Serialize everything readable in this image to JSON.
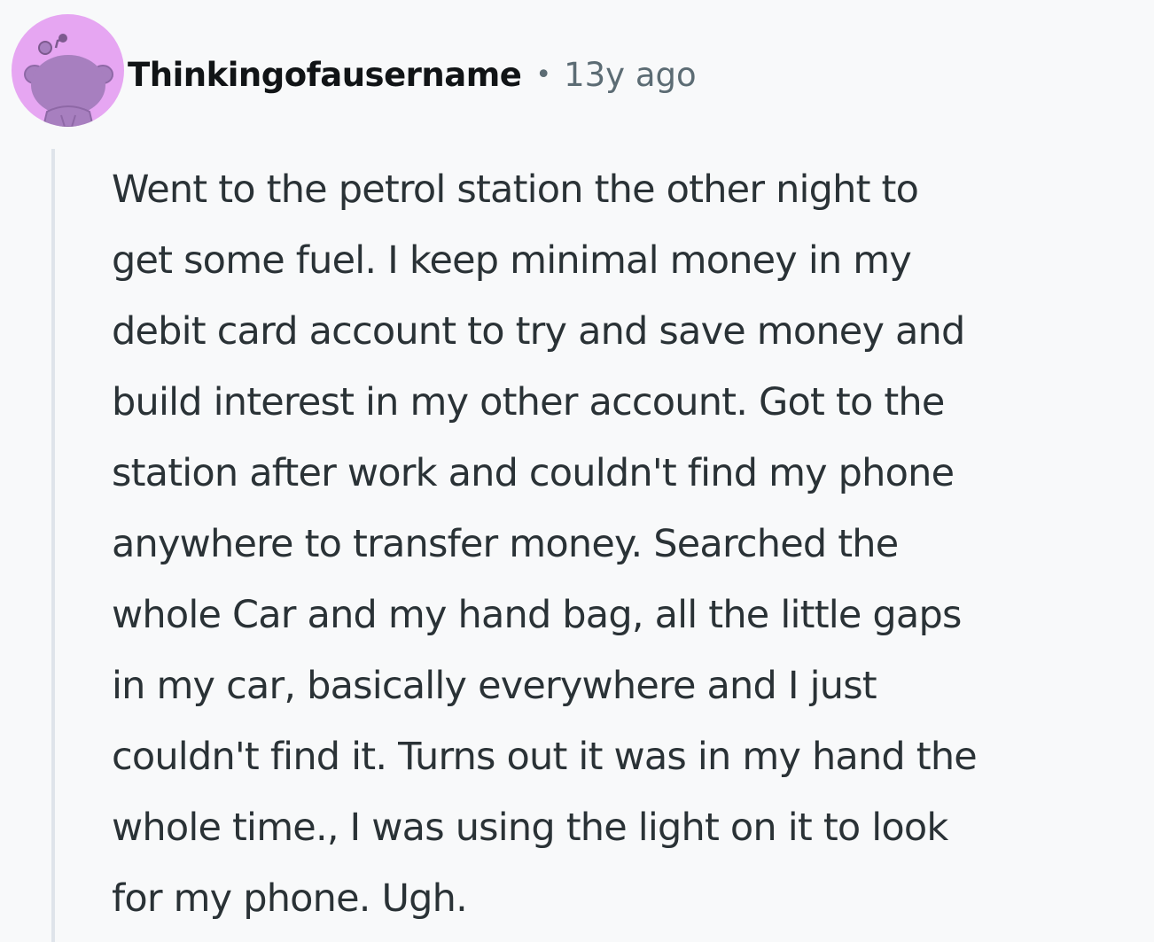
{
  "comment": {
    "author": "Thinkingofausername",
    "separator": "•",
    "timestamp": "13y ago",
    "body": "Went to the petrol station the other night to\nget some fuel. I keep minimal money in my\ndebit card account to try and save money and\nbuild interest in my other account. Got to the\nstation after work and couldn't find my phone\nanywhere to transfer money. Searched the\nwhole Car and my hand bag, all the little gaps\nin my car, basically everywhere and I just\ncouldn't find it. Turns out it was in my hand the\nwhole time., I was using the light on it to look\nfor my phone. Ugh."
  },
  "avatar": {
    "icon": "snoo-avatar-icon",
    "background_color": "#e6a6f2",
    "figure_color": "#a77fbf"
  },
  "colors": {
    "page_background": "#f8f9fa",
    "text": "#2a3236",
    "muted_text": "#5c6c74",
    "thread_line": "#dfe4ea"
  }
}
